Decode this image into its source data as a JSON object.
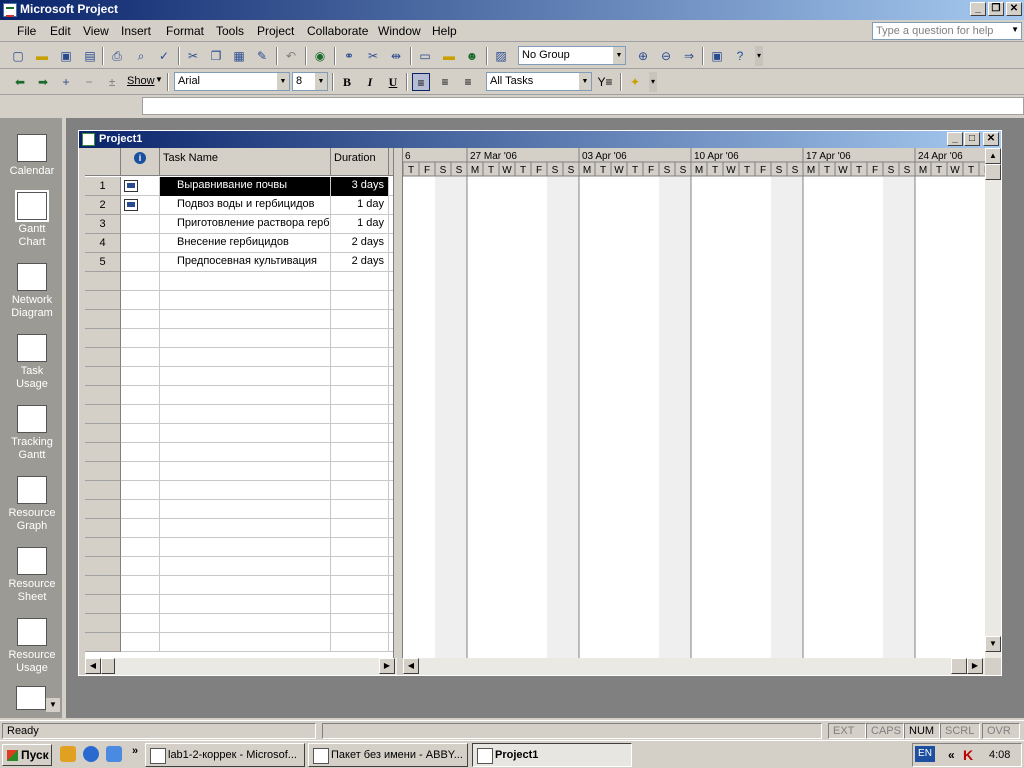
{
  "app": {
    "title": "Microsoft Project"
  },
  "menu": {
    "items": [
      "File",
      "Edit",
      "View",
      "Insert",
      "Format",
      "Tools",
      "Project",
      "Collaborate",
      "Window",
      "Help"
    ],
    "ask_placeholder": "Type a question for help"
  },
  "toolbar": {
    "group_value": "No Group",
    "show_label": "Show",
    "font_value": "Arial",
    "size_value": "8",
    "filter_value": "All Tasks",
    "bold": "B",
    "italic": "I",
    "underline": "U"
  },
  "viewbar": {
    "items": [
      {
        "line1": "Calendar",
        "line2": ""
      },
      {
        "line1": "Gantt",
        "line2": "Chart"
      },
      {
        "line1": "Network",
        "line2": "Diagram"
      },
      {
        "line1": "Task",
        "line2": "Usage"
      },
      {
        "line1": "Tracking",
        "line2": "Gantt"
      },
      {
        "line1": "Resource",
        "line2": "Graph"
      },
      {
        "line1": "Resource",
        "line2": "Sheet"
      },
      {
        "line1": "Resource",
        "line2": "Usage"
      }
    ]
  },
  "project": {
    "title": "Project1",
    "columns": {
      "indicator": "i",
      "name": "Task Name",
      "duration": "Duration"
    },
    "tasks": [
      {
        "id": "1",
        "name": "Выравнивание почвы",
        "duration": "3 days"
      },
      {
        "id": "2",
        "name": "Подвоз воды и гербицидов",
        "duration": "1 day"
      },
      {
        "id": "3",
        "name": "Приготовление раствора герб",
        "duration": "1 day"
      },
      {
        "id": "4",
        "name": "Внесение гербицидов",
        "duration": "2 days"
      },
      {
        "id": "5",
        "name": "Предпосевная культивация",
        "duration": "2 days"
      }
    ],
    "timescale": {
      "first_partial": "6",
      "weeks": [
        "27 Mar '06",
        "03 Apr '06",
        "10 Apr '06",
        "17 Apr '06",
        "24 Apr '06"
      ],
      "days": [
        "T",
        "F",
        "S",
        "S",
        "M",
        "T",
        "W",
        "T",
        "F",
        "S",
        "S",
        "M",
        "T",
        "W",
        "T",
        "F",
        "S",
        "S",
        "M",
        "T",
        "W",
        "T",
        "F",
        "S",
        "S",
        "M",
        "T",
        "W",
        "T",
        "F",
        "S",
        "S",
        "M",
        "T",
        "W",
        "T",
        "F"
      ]
    }
  },
  "status": {
    "ready": "Ready",
    "indicators": [
      "EXT",
      "CAPS",
      "NUM",
      "SCRL",
      "OVR"
    ]
  },
  "taskbar": {
    "start": "Пуск",
    "buttons": [
      "lab1-2-коррек - Microsof...",
      "Пакет без имени - ABBY...",
      "Project1"
    ],
    "lang": "EN",
    "clock": "4:08"
  }
}
